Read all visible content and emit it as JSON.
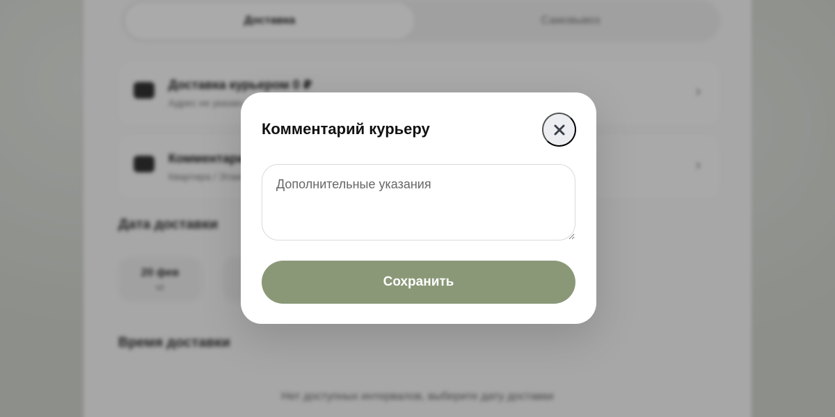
{
  "background": {
    "tabs": [
      {
        "label": "Доставка"
      },
      {
        "label": "Самовывоз"
      }
    ],
    "rows": [
      {
        "title": "Доставка курьером 0 ₽",
        "subtitle": "Адрес не указан"
      },
      {
        "title": "Комментарий",
        "subtitle": "Квартира / Этаж"
      }
    ],
    "date_heading": "Дата доставки",
    "date_card": {
      "day": "20 фев",
      "weekday": "чт"
    },
    "time_heading": "Время доставки",
    "empty_message": "Нет доступных интервалов, выберите дату доставки"
  },
  "modal": {
    "title": "Комментарий курьеру",
    "close_icon": "close-icon",
    "comment": {
      "value": "",
      "placeholder": "Дополнительные указания"
    },
    "save_label": "Сохранить"
  },
  "colors": {
    "save_button": "#8a9878",
    "close_button_bg": "#eceef1",
    "overlay": "rgba(0,0,0,0.32)"
  }
}
